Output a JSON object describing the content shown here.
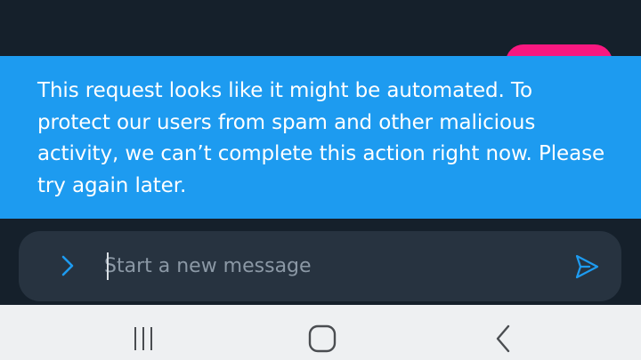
{
  "colors": {
    "background": "#15202b",
    "toast_background": "#1d9bf0",
    "accent_pink": "#f91880",
    "composer_background": "#273340",
    "icon_accent": "#1d9bf0",
    "navbar_background": "#eef0f2"
  },
  "toast": {
    "message": "This request looks like it might be automated. To protect our users from spam and other malicious activity, we can’t complete this action right now. Please try again later."
  },
  "composer": {
    "expand_icon": "chevron-right-icon",
    "placeholder": "Start a new message",
    "value": "",
    "send_icon": "send-icon"
  },
  "navbar": {
    "recents_icon": "recents-icon",
    "home_icon": "home-icon",
    "back_icon": "back-icon"
  }
}
